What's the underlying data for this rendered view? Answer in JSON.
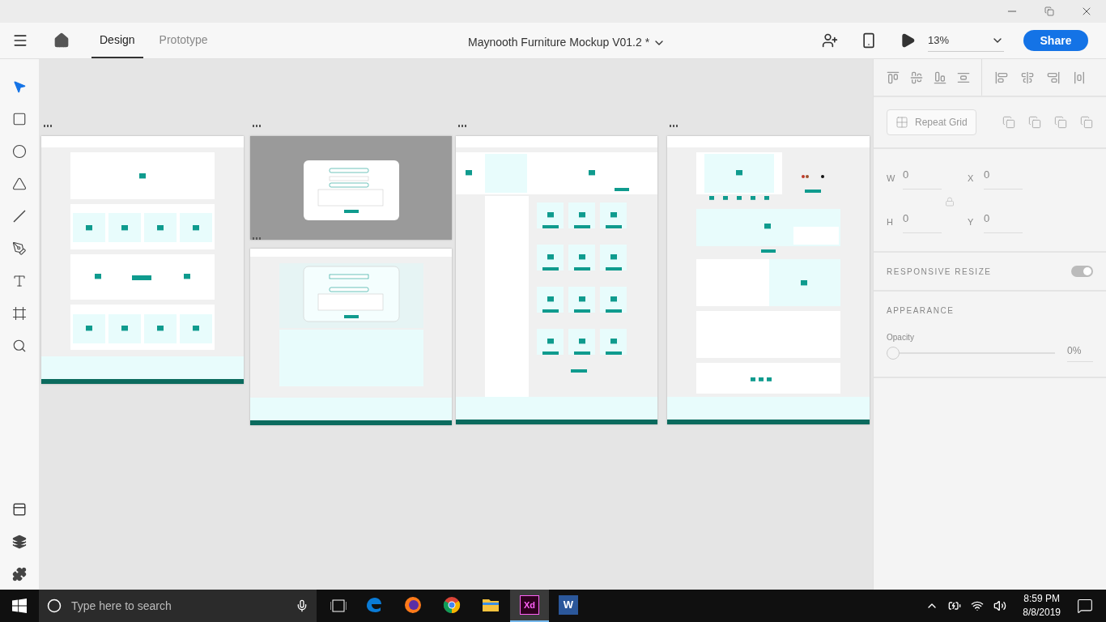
{
  "app_bar": {
    "tabs": [
      {
        "label": "Design",
        "selected": true
      },
      {
        "label": "Prototype",
        "selected": false
      }
    ],
    "document_title": "Maynooth Furniture Mockup V01.2 *",
    "zoom": "13%",
    "share_button": "Share"
  },
  "tools": [
    {
      "kind": "select",
      "selected": true
    },
    {
      "kind": "rectangle",
      "selected": false
    },
    {
      "kind": "ellipse",
      "selected": false
    },
    {
      "kind": "polygon",
      "selected": false
    },
    {
      "kind": "line",
      "selected": false
    },
    {
      "kind": "pen",
      "selected": false
    },
    {
      "kind": "text",
      "selected": false
    },
    {
      "kind": "artboard",
      "selected": false
    },
    {
      "kind": "zoom",
      "selected": false
    }
  ],
  "artboards": [
    {
      "kind": "home"
    },
    {
      "kind": "modal"
    },
    {
      "kind": "login"
    },
    {
      "kind": "listing"
    },
    {
      "kind": "product"
    }
  ],
  "properties": {
    "repeat_grid_button": "Repeat Grid",
    "fields": [
      {
        "label": "W",
        "value": "0"
      },
      {
        "label": "X",
        "value": "0"
      },
      {
        "label": "H",
        "value": "0"
      },
      {
        "label": "Y",
        "value": "0"
      }
    ],
    "responsive_resize": {
      "label": "RESPONSIVE RESIZE",
      "on": true
    },
    "appearance": {
      "title": "APPEARANCE",
      "opacity_label": "Opacity",
      "level": 0,
      "reading": "0%"
    }
  },
  "taskbar": {
    "search_placeholder": "Type here to search",
    "apps": [
      {
        "kind": "edge",
        "active": false
      },
      {
        "kind": "firefox",
        "active": false
      },
      {
        "kind": "chrome",
        "active": false
      },
      {
        "kind": "explorer",
        "active": false
      },
      {
        "kind": "xd",
        "label": "Xd",
        "active": true
      },
      {
        "kind": "word",
        "label": "W",
        "active": false
      }
    ],
    "time": "8:59 PM",
    "date": "8/8/2019"
  }
}
